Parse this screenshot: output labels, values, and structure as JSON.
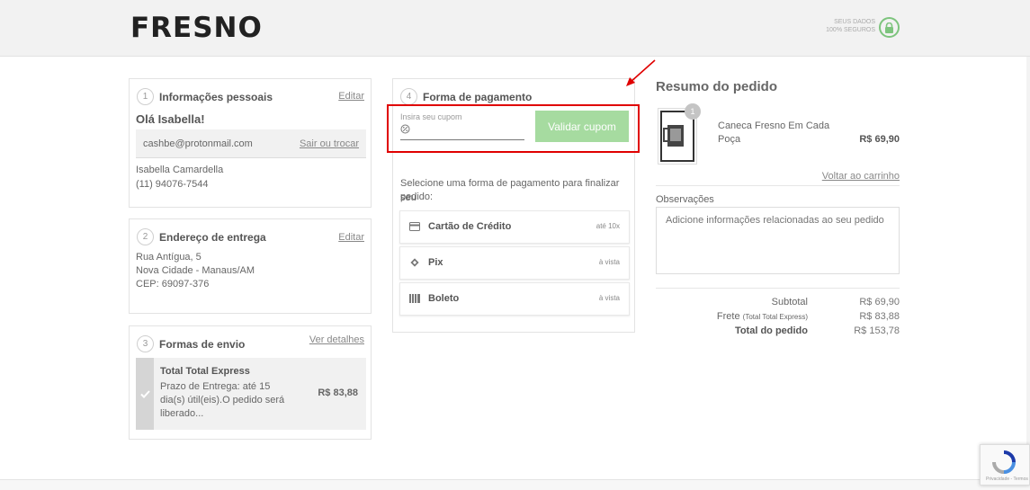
{
  "header": {
    "logo": "FRESNO",
    "secure_line1": "SEUS DADOS",
    "secure_line2": "100% SEGUROS"
  },
  "personal": {
    "step": "1",
    "title": "Informações pessoais",
    "edit": "Editar",
    "greeting": "Olá Isabella!",
    "email": "cashbe@protonmail.com",
    "switch": "Sair ou trocar",
    "name": "Isabella Camardella",
    "phone": "(11) 94076-7544"
  },
  "address": {
    "step": "2",
    "title": "Endereço de entrega",
    "edit": "Editar",
    "line1": "Rua Antígua, 5",
    "line2": "Nova Cidade - Manaus/AM",
    "line3": "CEP: 69097-376"
  },
  "shipping": {
    "step": "3",
    "title": "Formas de envio",
    "details": "Ver detalhes",
    "option_name": "Total Total Express",
    "option_desc_1": "Prazo de Entrega: até 15",
    "option_desc_2": "dia(s) útil(eis).O pedido será",
    "option_desc_3": "liberado...",
    "option_price": "R$ 83,88"
  },
  "payment": {
    "step": "4",
    "title": "Forma de pagamento",
    "coupon_label": "Insira seu cupom",
    "coupon_button": "Validar cupom",
    "instruction_1": "Selecione uma forma de pagamento para finalizar seu",
    "instruction_2": "pedido:",
    "options": [
      {
        "label": "Cartão de Crédito",
        "note": "até 10x"
      },
      {
        "label": "Pix",
        "note": "à vista"
      },
      {
        "label": "Boleto",
        "note": "à vista"
      }
    ]
  },
  "summary": {
    "title": "Resumo do pedido",
    "qty": "1",
    "product_line1": "Caneca Fresno Em Cada",
    "product_line2": "Poça",
    "product_price": "R$ 69,90",
    "back_to_cart": "Voltar ao carrinho",
    "notes_label": "Observações",
    "notes_placeholder": "Adicione informações relacionadas ao seu pedido",
    "subtotal_label": "Subtotal",
    "subtotal_value": "R$ 69,90",
    "freight_label": "Frete",
    "freight_detail": "(Total Total Express)",
    "freight_value": "R$ 83,88",
    "total_label": "Total do pedido",
    "total_value": "R$ 153,78"
  },
  "recaptcha": {
    "text": "Privacidade - Termos"
  },
  "colors": {
    "accent_green": "#a6dba0",
    "highlight_red": "#e00000"
  }
}
